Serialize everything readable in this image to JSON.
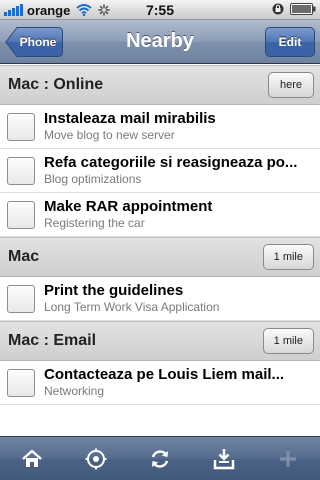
{
  "status_bar": {
    "carrier": "orange",
    "time": "7:55"
  },
  "nav": {
    "back_label": "Phone",
    "title": "Nearby",
    "edit_label": "Edit"
  },
  "sections": [
    {
      "title": "Mac : Online",
      "distance": "here",
      "tasks": [
        {
          "title": "Instaleaza mail mirabilis",
          "subtitle": "Move blog to new server"
        },
        {
          "title": "Refa categoriile si reasigneaza po...",
          "subtitle": "Blog optimizations"
        },
        {
          "title": "Make RAR appointment",
          "subtitle": "Registering the car"
        }
      ]
    },
    {
      "title": "Mac",
      "distance": "1 mile",
      "tasks": [
        {
          "title": "Print the guidelines",
          "subtitle": "Long Term Work Visa Application"
        }
      ]
    },
    {
      "title": "Mac : Email",
      "distance": "1 mile",
      "tasks": [
        {
          "title": "Contacteaza pe Louis Liem mail...",
          "subtitle": "Networking"
        }
      ]
    }
  ],
  "tab_bar": {
    "icons": [
      "home-icon",
      "compass-icon",
      "sync-icon",
      "inbox-download-icon",
      "add-icon"
    ]
  },
  "colors": {
    "nav_bar": "#7f91ab",
    "tab_bar": "#4b6186",
    "edit_button": "#3c63a8",
    "section_header": "#d8d8d8"
  }
}
